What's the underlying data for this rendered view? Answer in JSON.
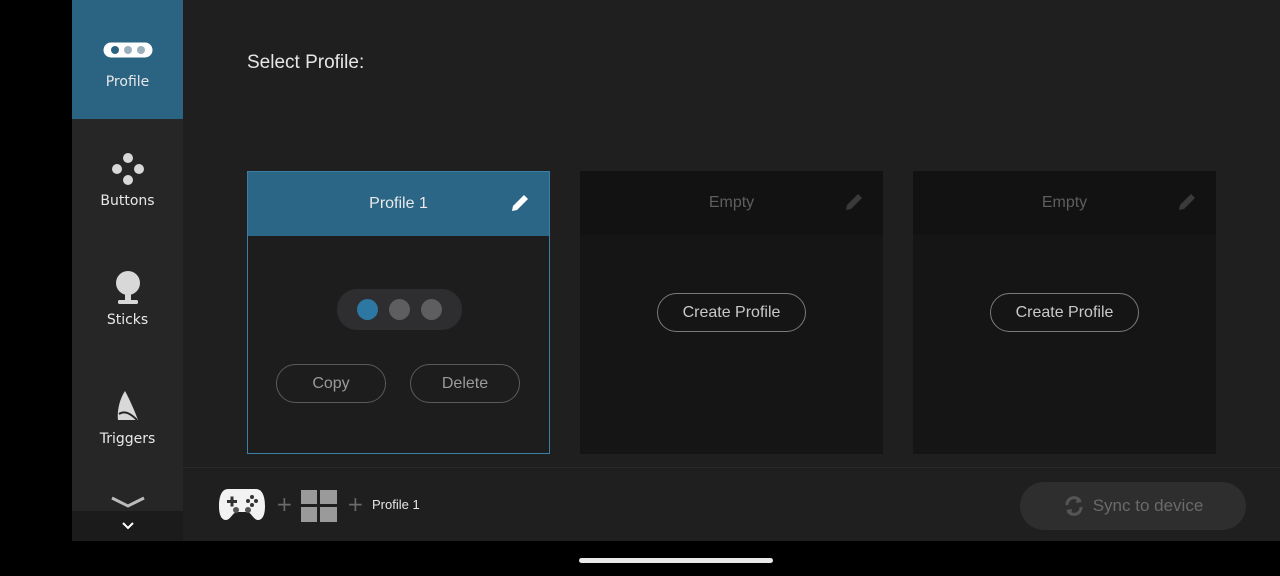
{
  "sidebar": {
    "items": [
      {
        "label": "Profile",
        "icon": "profile-dots-icon",
        "active": true
      },
      {
        "label": "Buttons",
        "icon": "dpad-buttons-icon",
        "active": false
      },
      {
        "label": "Sticks",
        "icon": "joystick-icon",
        "active": false
      },
      {
        "label": "Triggers",
        "icon": "trigger-icon",
        "active": false
      }
    ],
    "more_icon": "chevron-down-icon"
  },
  "main": {
    "title": "Select Profile:"
  },
  "cards": [
    {
      "title": "Profile 1",
      "state": "active",
      "copy_label": "Copy",
      "delete_label": "Delete",
      "indicator": "1 of 3"
    },
    {
      "title": "Empty",
      "state": "empty",
      "create_label": "Create Profile"
    },
    {
      "title": "Empty",
      "state": "empty",
      "create_label": "Create Profile"
    }
  ],
  "bottom": {
    "plus1": "+",
    "plus2": "+",
    "profile_label": "Profile 1",
    "sync_label": "Sync to device"
  },
  "colors": {
    "accent": "#2a6482",
    "background": "#1f1f20",
    "sidebar": "#262627"
  }
}
